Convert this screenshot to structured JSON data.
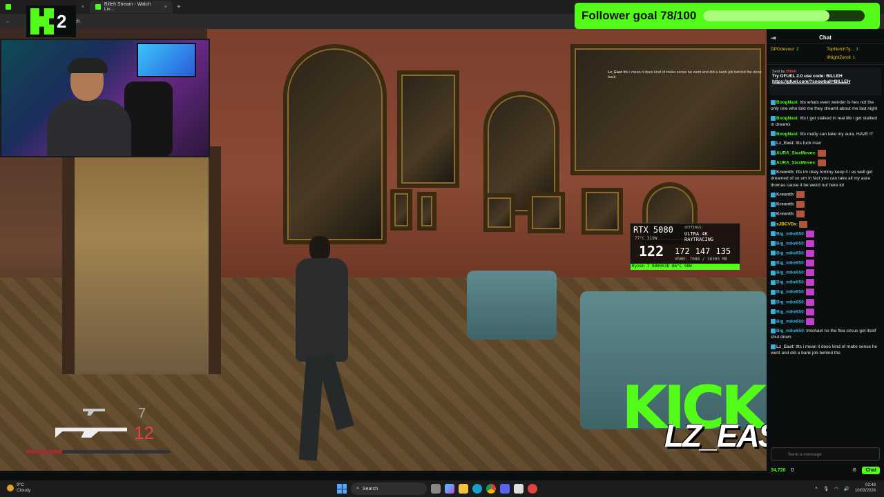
{
  "browser": {
    "tabs": [
      {
        "title": "",
        "active": false
      },
      {
        "title": "Billeh Stream - Watch Liv...",
        "active": true
      }
    ],
    "url_fragment": "lleh",
    "kick_logo_number": "2"
  },
  "follower_goal": {
    "label": "Follower goal 78/100",
    "current": 78,
    "target": 100
  },
  "hud": {
    "gpu": "RTX 5080",
    "gpu_stats": "77°C 319W",
    "settings_label": "SETTINGS:",
    "preset": "ULTRA 4K RAYTRACING",
    "fps": "122",
    "avg": "172",
    "low1": "147",
    "low01": "135",
    "vram": "VRAM: 7088 / 16303 MB",
    "cpu": "Ryzen 7 9800X3D   86°C  98W",
    "ammo_reserve": "7",
    "ammo_clip": "12",
    "health_fraction": 0.25
  },
  "overlay": {
    "kick_word": "KICK",
    "streamer_name": "LZ_EAST"
  },
  "chat": {
    "header": "Chat",
    "leaderboard": [
      {
        "name": "DPGdevour",
        "value": "2"
      },
      {
        "name": "TopNotchTy...",
        "value": "1"
      },
      {
        "name": "",
        "value": ""
      },
      {
        "name": "IlNightZeroll",
        "value": "1"
      }
    ],
    "pinned": {
      "sent_by_label": "Sent by",
      "sent_by": "Billeh",
      "message": "Try GFUEL 2.0 use code: BILLEH",
      "link": "https://gfuel.com/?snowball=BILLEH"
    },
    "messages": [
      {
        "user": "BoogNast",
        "color": "#53fc18",
        "text": "ttts whats even weirder is hes not the only one who told me they dreamt about me last night"
      },
      {
        "user": "BoogNast",
        "color": "#53fc18",
        "text": "ttts I get stalked in real life i get stalked in dreams"
      },
      {
        "user": "BoogNast",
        "color": "#53fc18",
        "text": "ttts matty can take my aura. HAVE IT"
      },
      {
        "user": "Lz_East",
        "color": "#c6c6c6",
        "text": "ttts fuck man"
      },
      {
        "user": "AURA_SixxMoves",
        "color": "#53fc18",
        "text": ""
      },
      {
        "user": "AURA_SixxMoves",
        "color": "#53fc18",
        "text": ""
      },
      {
        "user": "Kreonth",
        "color": "#c6c6c6",
        "text": "ttts im okay tommy keep it i as well get dreamed of so um in fact you can take all my aura thomas cause it be weird out here lol"
      },
      {
        "user": "Kreonth",
        "color": "#c6c6c6",
        "text": ""
      },
      {
        "user": "Kreonth",
        "color": "#c6c6c6",
        "text": ""
      },
      {
        "user": "Kreonth",
        "color": "#c6c6c6",
        "text": ""
      },
      {
        "user": "xJBCVDx",
        "color": "#f5c518",
        "text": ""
      },
      {
        "user": "Big_mike650",
        "color": "#3ab0d8",
        "text": ""
      },
      {
        "user": "Big_mike650",
        "color": "#3ab0d8",
        "text": ""
      },
      {
        "user": "Big_mike650",
        "color": "#3ab0d8",
        "text": ""
      },
      {
        "user": "Big_mike650",
        "color": "#3ab0d8",
        "text": ""
      },
      {
        "user": "Big_mike650",
        "color": "#3ab0d8",
        "text": ""
      },
      {
        "user": "Big_mike650",
        "color": "#3ab0d8",
        "text": ""
      },
      {
        "user": "Big_mike650",
        "color": "#3ab0d8",
        "text": ""
      },
      {
        "user": "Big_mike650",
        "color": "#3ab0d8",
        "text": ""
      },
      {
        "user": "Big_mike650",
        "color": "#3ab0d8",
        "text": ""
      },
      {
        "user": "Big_mike650",
        "color": "#3ab0d8",
        "text": ""
      },
      {
        "user": "Big_mike650",
        "color": "#3ab0d8",
        "text": "tmichael no the flea circus got itself shut down"
      },
      {
        "user": "Lz_East",
        "color": "#c6c6c6",
        "text": "ttts i mean it does kind of make sense he went and did a bank job behind the"
      }
    ],
    "input_placeholder": "Send a message",
    "points": "34,720",
    "zero": "0",
    "send_label": "Chat"
  },
  "game_chat_overlay": {
    "user": "Lz_East",
    "text": "ttts i mean it does kind of make sense he went and did a bank job behind the done back"
  },
  "taskbar": {
    "weather_temp": "9°C",
    "weather_desc": "Cloudy",
    "search_label": "Search",
    "time": "02:48",
    "date": "10/03/2026"
  }
}
